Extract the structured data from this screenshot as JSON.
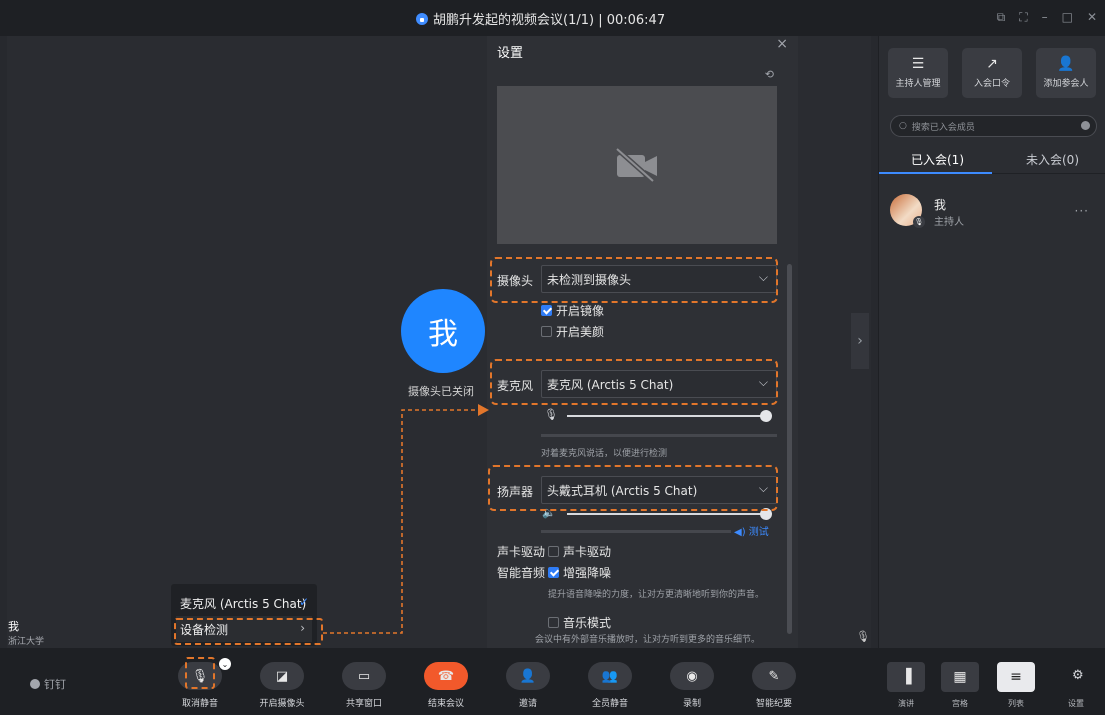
{
  "window": {
    "title": "胡鹏升发起的视频会议(1/1) | 00:06:47"
  },
  "stage": {
    "avatar_char": "我",
    "camera_status": "摄像头已关闭",
    "self_name": "我",
    "self_org": "浙江大学"
  },
  "settings": {
    "title": "设置",
    "camera": {
      "label": "摄像头",
      "value": "未检测到摄像头",
      "mirror_label": "开启镜像",
      "mirror_checked": true,
      "beauty_label": "开启美颜",
      "beauty_checked": false
    },
    "microphone": {
      "label": "麦克风",
      "value": "麦克风 (Arctis 5 Chat)",
      "volume_level": 1.0,
      "hint": "对着麦克风说话，以便进行检测"
    },
    "speaker": {
      "label": "扬声器",
      "value": "头戴式耳机 (Arctis 5 Chat)",
      "volume_level": 1.0,
      "test_label": "测试"
    },
    "soundcard": {
      "label": "声卡驱动",
      "option": "声卡驱动",
      "checked": false
    },
    "smart_audio": {
      "label": "智能音频",
      "option": "增强降噪",
      "checked": true,
      "hint": "提升语音降噪的力度，让对方更清晰地听到你的声音。"
    },
    "music_mode": {
      "option": "音乐模式",
      "checked": false,
      "hint": "会议中有外部音乐播放时，让对方听到更多的音乐细节。"
    }
  },
  "mic_popup": {
    "device": "麦克风 (Arctis 5 Chat)",
    "device_check": "设备检测"
  },
  "right_panel": {
    "buttons": [
      {
        "label": "主持人管理",
        "icon": "sliders-icon"
      },
      {
        "label": "入会口令",
        "icon": "share-icon"
      },
      {
        "label": "添加参会人",
        "icon": "add-user-icon"
      }
    ],
    "search_placeholder": "搜索已入会成员",
    "tab_joined": "已入会(1)",
    "tab_not_joined": "未入会(0)",
    "member": {
      "name": "我",
      "role": "主持人"
    }
  },
  "toolbar": {
    "brand": "钉钉",
    "buttons": [
      {
        "label": "取消静音",
        "icon": "mic-muted-icon"
      },
      {
        "label": "开启摄像头",
        "icon": "camera-off-icon"
      },
      {
        "label": "共享窗口",
        "icon": "share-screen-icon"
      },
      {
        "label": "结束会议",
        "icon": "hangup-icon"
      },
      {
        "label": "邀请",
        "icon": "invite-icon"
      },
      {
        "label": "全员静音",
        "icon": "mute-all-icon"
      },
      {
        "label": "录制",
        "icon": "record-icon"
      },
      {
        "label": "智能纪要",
        "icon": "notes-icon"
      }
    ],
    "views": [
      {
        "label": "演讲"
      },
      {
        "label": "宫格"
      },
      {
        "label": "列表"
      }
    ],
    "settings_label": "设置"
  },
  "colors": {
    "accent": "#1f86ff",
    "end_call": "#f2592b",
    "highlight": "#e2762b"
  }
}
